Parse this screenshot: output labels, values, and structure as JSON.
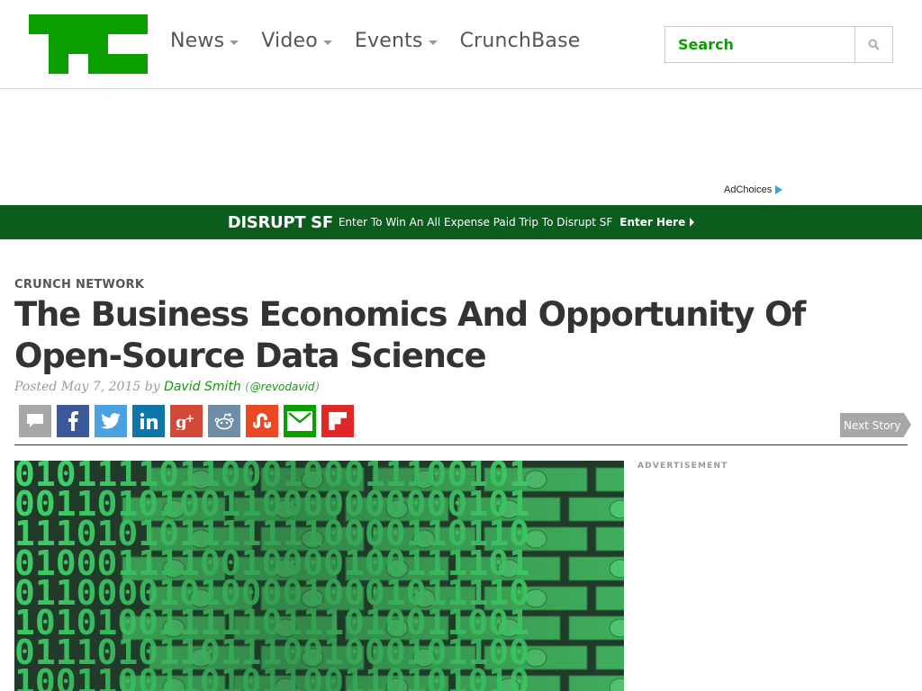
{
  "header": {
    "logo_alt": "TechCrunch",
    "nav": [
      {
        "label": "News",
        "has_dropdown": true
      },
      {
        "label": "Video",
        "has_dropdown": true
      },
      {
        "label": "Events",
        "has_dropdown": true
      },
      {
        "label": "CrunchBase",
        "has_dropdown": false
      }
    ],
    "search": {
      "placeholder": "Search"
    }
  },
  "ad": {
    "adchoices_label": "AdChoices"
  },
  "banner": {
    "brand": "DISRUPT SF",
    "message": "Enter To Win An All Expense Paid Trip To Disrupt SF",
    "cta": "Enter Here"
  },
  "article": {
    "kicker": "CRUNCH NETWORK",
    "title": "The Business Economics And Opportunity Of Open-Source Data Science",
    "posted_prefix": "Posted",
    "date": "May 7, 2015",
    "by": "by",
    "author": "David Smith",
    "handle": "@revodavid",
    "next_story": "Next Story",
    "ad_label": "ADVERTISEMENT"
  },
  "share_buttons": [
    {
      "name": "comment",
      "color": "#a7a7a7",
      "icon": "comment-icon"
    },
    {
      "name": "facebook",
      "color": "#3b5998",
      "icon": "facebook-icon"
    },
    {
      "name": "twitter",
      "color": "#4aa0e1",
      "icon": "twitter-icon"
    },
    {
      "name": "linkedin",
      "color": "#0e76a8",
      "icon": "linkedin-icon"
    },
    {
      "name": "google-plus",
      "color": "#d34836",
      "icon": "google-plus-icon"
    },
    {
      "name": "reddit",
      "color": "#6e8ea5",
      "icon": "reddit-icon"
    },
    {
      "name": "stumbleupon",
      "color": "#eb4924",
      "icon": "stumbleupon-icon"
    },
    {
      "name": "email",
      "color": "#0a9e01",
      "icon": "email-icon"
    },
    {
      "name": "flipboard",
      "color": "#e12828",
      "icon": "flipboard-icon"
    }
  ],
  "colors": {
    "brand_green": "#0a9e01",
    "banner_green": "#0b5d1e"
  }
}
